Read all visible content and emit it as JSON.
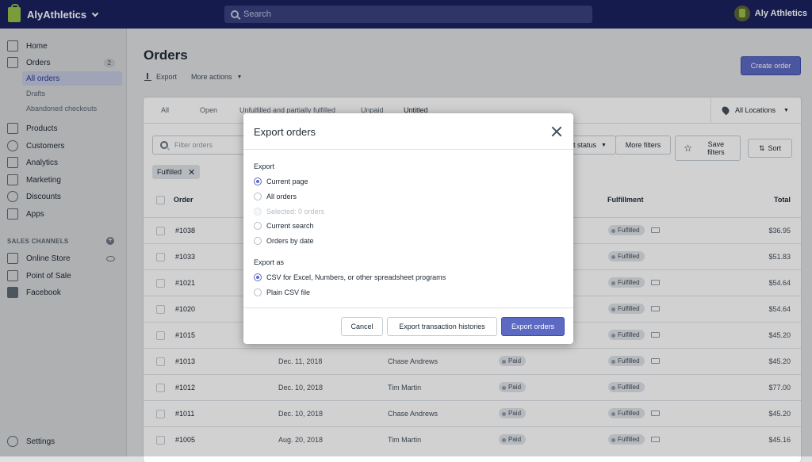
{
  "topbar": {
    "store": "AlyAthletics",
    "search_placeholder": "Search",
    "user": "Aly Athletics"
  },
  "sidebar": {
    "home": "Home",
    "orders": "Orders",
    "orders_badge": "2",
    "all_orders": "All orders",
    "drafts": "Drafts",
    "abandoned": "Abandoned checkouts",
    "products": "Products",
    "customers": "Customers",
    "analytics": "Analytics",
    "marketing": "Marketing",
    "discounts": "Discounts",
    "apps": "Apps",
    "sales_channels": "SALES CHANNELS",
    "online_store": "Online Store",
    "pos": "Point of Sale",
    "facebook": "Facebook",
    "settings": "Settings"
  },
  "page": {
    "title": "Orders",
    "export": "Export",
    "more_actions": "More actions",
    "create": "Create order"
  },
  "tabs": [
    "All",
    "Open",
    "Unfulfilled and partially fulfilled",
    "Unpaid",
    "Untitled"
  ],
  "locations": "All Locations",
  "filters": {
    "placeholder": "Filter orders",
    "status": "t status",
    "more": "More filters",
    "save": "Save filters",
    "sort": "Sort",
    "tag": "Fulfilled"
  },
  "table": {
    "headers": {
      "order": "Order",
      "fulfillment": "Fulfillment",
      "total": "Total"
    },
    "rows": [
      {
        "order": "#1038",
        "date": "",
        "customer": "",
        "payment": "",
        "fulfillment": "Fulfilled",
        "total": "$36.95",
        "truck": true
      },
      {
        "order": "#1033",
        "date": "",
        "customer": "",
        "payment": "",
        "fulfillment": "Fulfilled",
        "total": "$51.83",
        "truck": false
      },
      {
        "order": "#1021",
        "date": "",
        "customer": "",
        "payment": "",
        "fulfillment": "Fulfilled",
        "total": "$54.64",
        "truck": true
      },
      {
        "order": "#1020",
        "date": "",
        "customer": "",
        "payment": "",
        "fulfillment": "Fulfilled",
        "total": "$54.64",
        "truck": true
      },
      {
        "order": "#1015",
        "date": "",
        "customer": "",
        "payment": "",
        "fulfillment": "Fulfilled",
        "total": "$45.20",
        "truck": true
      },
      {
        "order": "#1013",
        "date": "Dec. 11, 2018",
        "customer": "Chase Andrews",
        "payment": "Paid",
        "fulfillment": "Fulfilled",
        "total": "$45.20",
        "truck": true
      },
      {
        "order": "#1012",
        "date": "Dec. 10, 2018",
        "customer": "Tim Martin",
        "payment": "Paid",
        "fulfillment": "Fulfilled",
        "total": "$77.00",
        "truck": false
      },
      {
        "order": "#1011",
        "date": "Dec. 10, 2018",
        "customer": "Chase Andrews",
        "payment": "Paid",
        "fulfillment": "Fulfilled",
        "total": "$45.20",
        "truck": true
      },
      {
        "order": "#1005",
        "date": "Aug. 20, 2018",
        "customer": "Tim Martin",
        "payment": "Paid",
        "fulfillment": "Fulfilled",
        "total": "$45.16",
        "truck": true
      }
    ]
  },
  "modal": {
    "title": "Export orders",
    "export_label": "Export",
    "export_options": [
      "Current page",
      "All orders",
      "Selected: 0 orders",
      "Current search",
      "Orders by date"
    ],
    "export_as_label": "Export as",
    "format_options": [
      "CSV for Excel, Numbers, or other spreadsheet programs",
      "Plain CSV file"
    ],
    "cancel": "Cancel",
    "export_histories": "Export transaction histories",
    "export_orders": "Export orders"
  }
}
